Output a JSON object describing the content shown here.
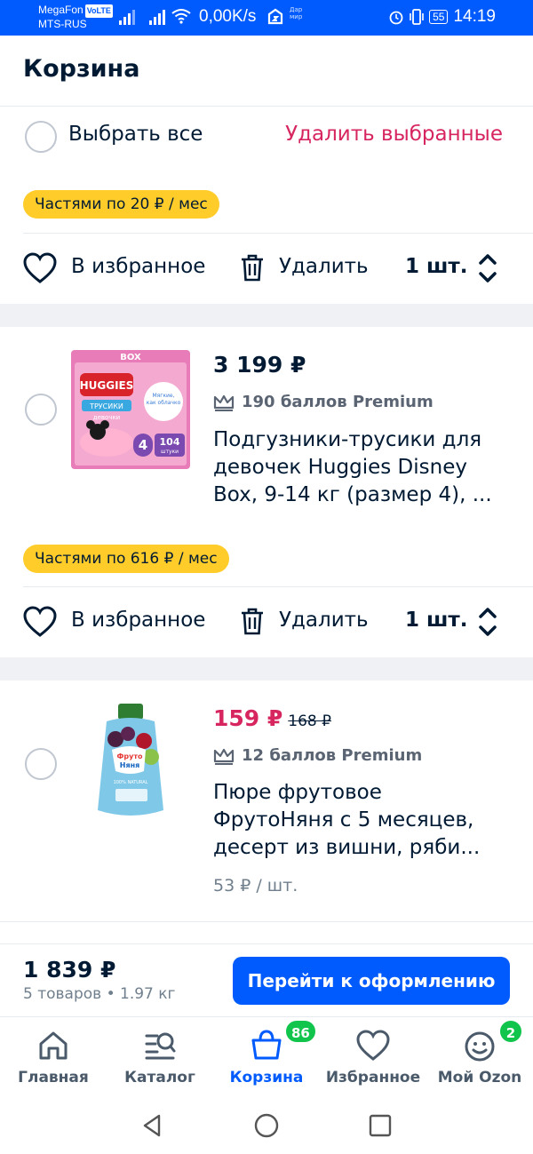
{
  "status_bar": {
    "carrier1": "MegaFon",
    "volte": "VoLTE",
    "carrier2": "MTS-RUS",
    "speed": "0,00K/s",
    "mir": "Дар мир",
    "battery": "55",
    "time": "14:19"
  },
  "header": {
    "title": "Корзина"
  },
  "select_all": {
    "label": "Выбрать все",
    "delete_selected": "Удалить выбранные"
  },
  "actions": {
    "favorite": "В избранное",
    "delete": "Удалить"
  },
  "groups": [
    {
      "installment": "Частями по 20 ₽ / мес",
      "qty": "1 шт."
    },
    {
      "installment": "Частями по 616 ₽ / мес",
      "qty": "1 шт."
    }
  ],
  "products": [
    {
      "price": "3 199 ₽",
      "bonus": "190 баллов Premium",
      "title_lines": [
        "Подгузники-трусики для",
        "девочек Huggies Disney",
        "Box, 9-14 кг (размер 4), ..."
      ],
      "thumb_text": {
        "box": "BOX",
        "brand": "HUGGIES",
        "kind": "ТРУСИКИ",
        "girls": "девочки",
        "size": "4",
        "count": "104",
        "pcs": "штуки",
        "cloud": "Мягкие, как облачко"
      }
    },
    {
      "price": "159 ₽",
      "old_price": "168 ₽",
      "bonus": "12 баллов Premium",
      "title_lines": [
        "Пюре фрутовое",
        "ФрутоНяня с 5 месяцев,",
        "десерт из вишни, ряби..."
      ],
      "unit_price": "53 ₽ / шт.",
      "thumb_text": {
        "brand_top": "Фруто",
        "brand_bottom": "Няня",
        "natural": "100% NATURAL"
      }
    }
  ],
  "checkout": {
    "total": "1 839 ₽",
    "summary": "5 товаров • 1.97 кг",
    "button": "Перейти к оформлению"
  },
  "tabs": [
    {
      "label": "Главная",
      "icon": "home-icon"
    },
    {
      "label": "Каталог",
      "icon": "catalog-icon"
    },
    {
      "label": "Корзина",
      "icon": "cart-icon",
      "badge": "86",
      "active": true
    },
    {
      "label": "Избранное",
      "icon": "heart-icon"
    },
    {
      "label": "Мой Ozon",
      "icon": "smile-icon",
      "badge": "2"
    }
  ],
  "colors": {
    "brand": "#005bff",
    "accent_red": "#d7265f",
    "badge_yellow": "#ffcc2a",
    "badge_green": "#10c44c"
  }
}
